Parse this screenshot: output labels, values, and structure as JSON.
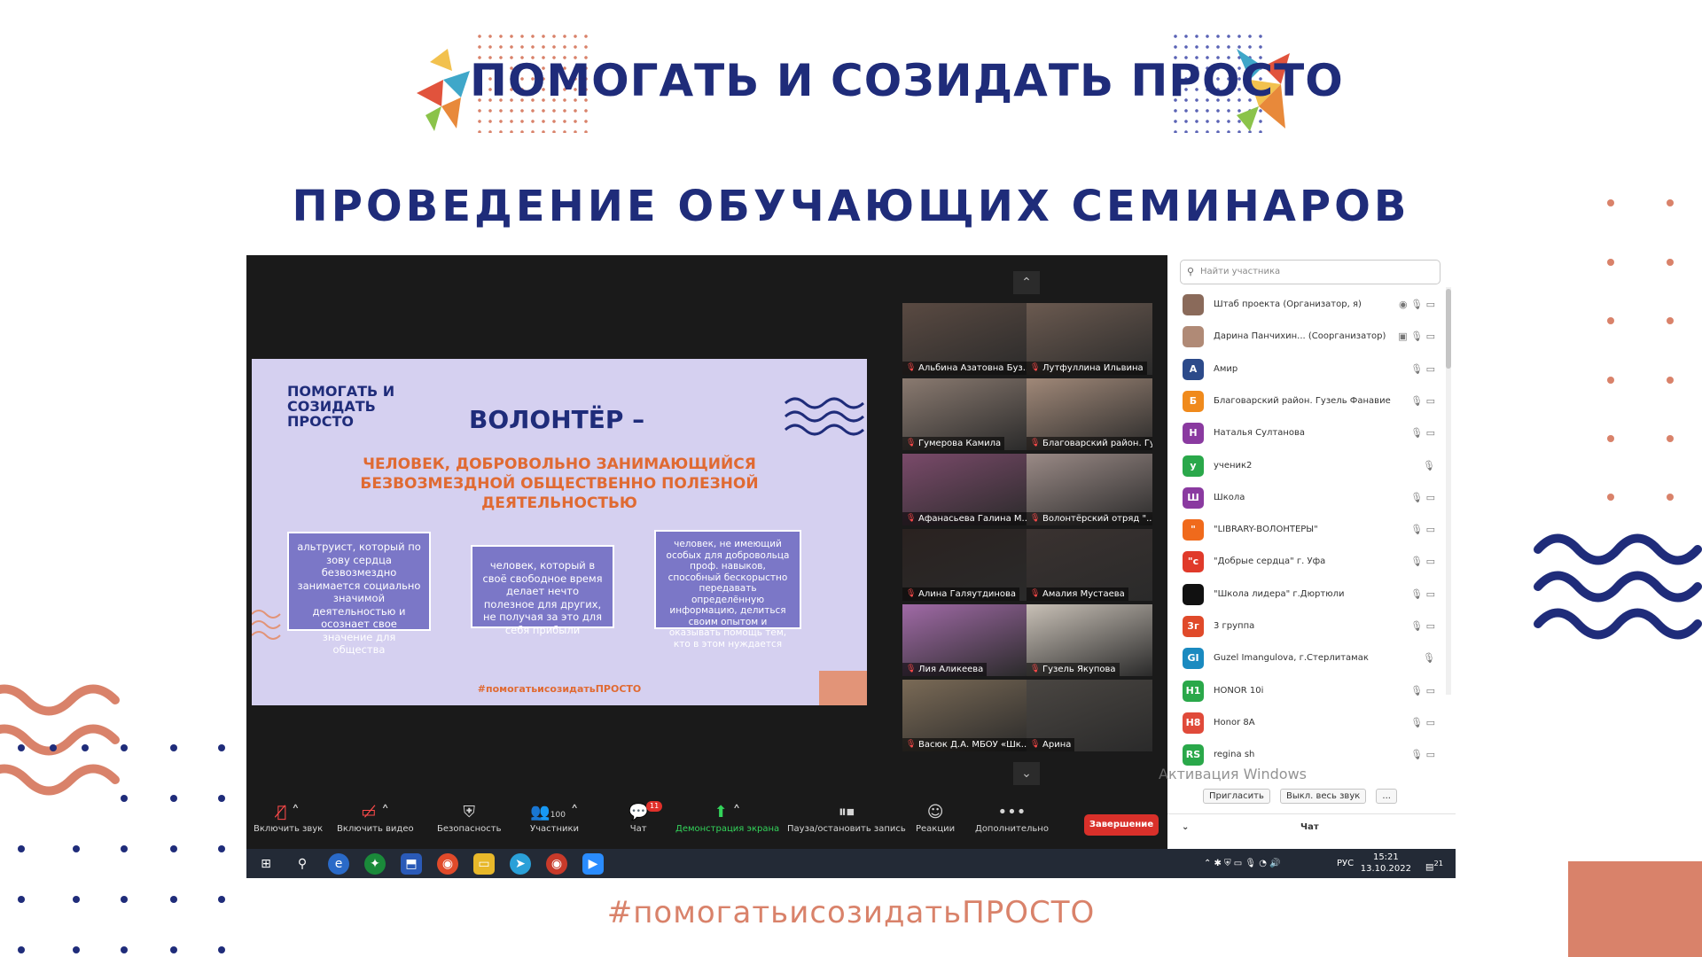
{
  "logo": {
    "text": "ПОМОГАТЬ И СОЗИДАТЬ ПРОСТО"
  },
  "page_title": "ПРОВЕДЕНИЕ ОБУЧАЮЩИХ СЕМИНАРОВ",
  "hashtag": "#помогатьисозидатьПРОСТО",
  "colors": {
    "navy": "#1f2c7a",
    "peach": "#d9826a",
    "zoom_dark": "#1a1a1a",
    "end_red": "#d9302a",
    "share_green": "#33d35a"
  },
  "slide": {
    "logo_text": "ПОМОГАТЬ И СОЗИДАТЬ ПРОСТО",
    "title": "ВОЛОНТЁР –",
    "subtitle": "ЧЕЛОВЕК, ДОБРОВОЛЬНО ЗАНИМАЮЩИЙСЯ БЕЗВОЗМЕЗДНОЙ ОБЩЕСТВЕННО ПОЛЕЗНОЙ ДЕЯТЕЛЬНОСТЬЮ",
    "box1": "альтруист, который по зову сердца безвозмездно занимается социально значимой деятельностью и осознает свое значение для общества",
    "box2": "человек, который в своё свободное время делает нечто полезное для других, не получая за это для себя прибыли",
    "box3": "человек, не имеющий особых для добровольца проф. навыков, способный бескорыстно передавать определённую информацию, делиться своим опытом и оказывать помощь тем, кто в этом нуждается",
    "hashtag": "#помогатьисозидатьПРОСТО"
  },
  "gallery": {
    "tiles": [
      {
        "name": "Альбина Азатовна Буз...",
        "color": "#5a4a42"
      },
      {
        "name": "Лутфуллина Ильвина",
        "color": "#6b5a50"
      },
      {
        "name": "Гумерова Камила",
        "color": "#8a7a70"
      },
      {
        "name": "Благоварский район. Гуз...",
        "color": "#a08878"
      },
      {
        "name": "Афанасьева Галина М...",
        "color": "#7a4a6a"
      },
      {
        "name": "Волонтёрский отряд \"...",
        "color": "#9a8a86"
      },
      {
        "name": "Алина Галяутдинова",
        "color": "#2a2220"
      },
      {
        "name": "Амалия Мустаева",
        "color": "#3a3230"
      },
      {
        "name": "Лия Аликеева",
        "color": "#a06aa6"
      },
      {
        "name": "Гузель Якупова",
        "color": "#c8c0b6"
      },
      {
        "name": "Васюк Д.А. МБОУ «Шк...",
        "color": "#7a6a56"
      },
      {
        "name": "Арина",
        "color": "#4a4642"
      }
    ]
  },
  "panel": {
    "search_placeholder": "Найти участника",
    "participants": [
      {
        "initial": "",
        "name": "Штаб проекта (Организатор, я)",
        "color": "#8a6a5a",
        "icons": "◉ 🎙 ▭"
      },
      {
        "initial": "",
        "name": "Дарина Панчихин... (Соорганизатор)",
        "color": "#b08a76",
        "icons": "▣ 🎙 ▭"
      },
      {
        "initial": "А",
        "name": "Амир",
        "color": "#2c4a8a",
        "icons": "🎙 ▭"
      },
      {
        "initial": "Б",
        "name": "Благоварский район. Гузель Фанавиевна",
        "color": "#f08a1c",
        "icons": "🎙 ▭"
      },
      {
        "initial": "Н",
        "name": "Наталья Султанова",
        "color": "#8a3aa0",
        "icons": "🎙 ▭"
      },
      {
        "initial": "у",
        "name": "ученик2",
        "color": "#2aa84a",
        "icons": "🎙"
      },
      {
        "initial": "Ш",
        "name": "Школа",
        "color": "#8a3aa0",
        "icons": "🎙 ▭"
      },
      {
        "initial": "\"",
        "name": "\"LIBRARY-ВОЛОНТЕРЫ\"",
        "color": "#f06a1c",
        "icons": "🎙 ▭"
      },
      {
        "initial": "\"с",
        "name": "\"Добрые сердца\" г. Уфа",
        "color": "#e03a2a",
        "icons": "🎙 ▭"
      },
      {
        "initial": "",
        "name": "\"Школа лидера\" г.Дюртюли",
        "color": "#111111",
        "icons": "🎙 ▭"
      },
      {
        "initial": "3г",
        "name": "3 группа",
        "color": "#e04a2a",
        "icons": "🎙 ▭"
      },
      {
        "initial": "GI",
        "name": "Guzel Imangulova, г.Стерлитамак",
        "color": "#1a8ac0",
        "icons": "🎙"
      },
      {
        "initial": "H1",
        "name": "HONOR 10i",
        "color": "#2aa84a",
        "icons": "🎙 ▭"
      },
      {
        "initial": "H8",
        "name": "Honor 8A",
        "color": "#e04a3a",
        "icons": "🎙 ▭"
      },
      {
        "initial": "RS",
        "name": "regina sh",
        "color": "#2aa84a",
        "icons": "🎙 ▭"
      }
    ],
    "invite_button": "Пригласить",
    "mute_all_button": "Выкл. весь звук",
    "more_button": "...",
    "chat_label": "Чат",
    "windows_activation": "Активация Windows"
  },
  "toolbar": {
    "audio": "Включить звук",
    "video": "Включить видео",
    "security": "Безопасность",
    "participants": "Участники",
    "participants_count": "100",
    "chat": "Чат",
    "chat_badge": "11",
    "share": "Демонстрация экрана",
    "record": "Пауза/остановить запись",
    "reactions": "Реакции",
    "more": "Дополнительно",
    "end": "Завершение"
  },
  "taskbar": {
    "lang": "РУС",
    "time": "15:21",
    "date": "13.10.2022",
    "notifications": "21"
  }
}
